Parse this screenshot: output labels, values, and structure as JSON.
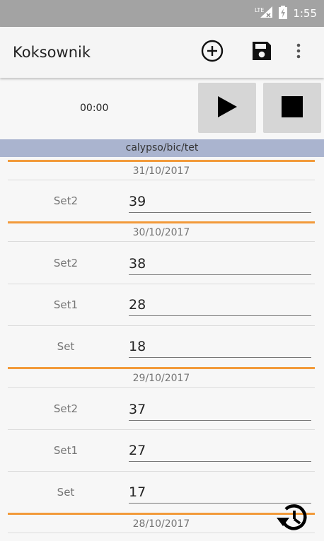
{
  "status_bar": {
    "network": "LTE",
    "time": "1:55",
    "icons": [
      "lte-signal-icon",
      "battery-charging-icon"
    ]
  },
  "app_bar": {
    "title": "Koksownik",
    "actions": [
      "add-circle-icon",
      "save-icon",
      "more-vert-icon"
    ]
  },
  "timer": {
    "time": "00:00",
    "controls": [
      "play-icon",
      "stop-icon"
    ]
  },
  "exercise": {
    "name": "calypso/bic/tet"
  },
  "days": [
    {
      "date": "31/10/2017",
      "sets": [
        {
          "label": "Set2",
          "value": "39"
        }
      ]
    },
    {
      "date": "30/10/2017",
      "sets": [
        {
          "label": "Set2",
          "value": "38"
        },
        {
          "label": "Set1",
          "value": "28"
        },
        {
          "label": "Set",
          "value": "18"
        }
      ]
    },
    {
      "date": "29/10/2017",
      "sets": [
        {
          "label": "Set2",
          "value": "37"
        },
        {
          "label": "Set1",
          "value": "27"
        },
        {
          "label": "Set",
          "value": "17"
        }
      ]
    },
    {
      "date": "28/10/2017",
      "sets": []
    }
  ],
  "fab": {
    "icon": "history-icon"
  },
  "colors": {
    "status_bar": "#a3a3a3",
    "app_bar": "#f5f5f5",
    "exercise_header": "#aab4cf",
    "day_divider": "#f29a3a",
    "button_bg": "#d6d6d6"
  }
}
